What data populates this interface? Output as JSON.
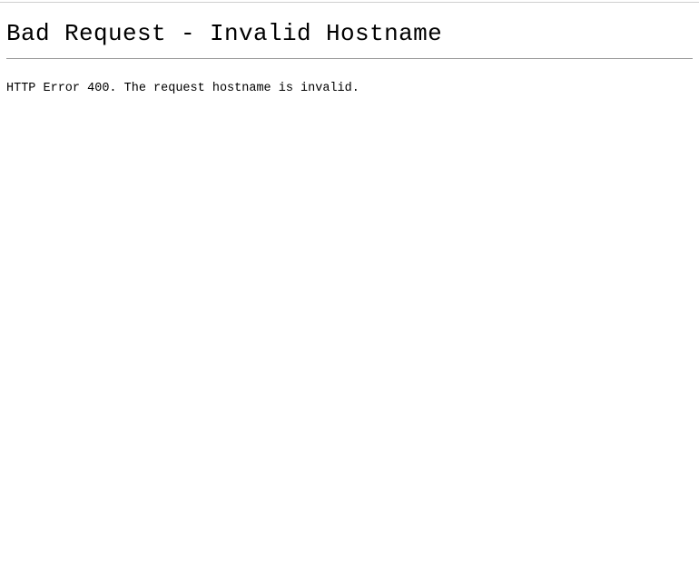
{
  "document": {
    "title": "Bad Request - Invalid Hostname",
    "background_color": "#ffffff",
    "text_color": "#000000"
  },
  "error": {
    "heading": "Bad Request - Invalid Hostname",
    "status_code": "400",
    "message": "HTTP Error 400. The request hostname is invalid."
  },
  "rules": {
    "top_rule_color": "#cfcfcf",
    "heading_rule_color": "#9a9a9a"
  }
}
